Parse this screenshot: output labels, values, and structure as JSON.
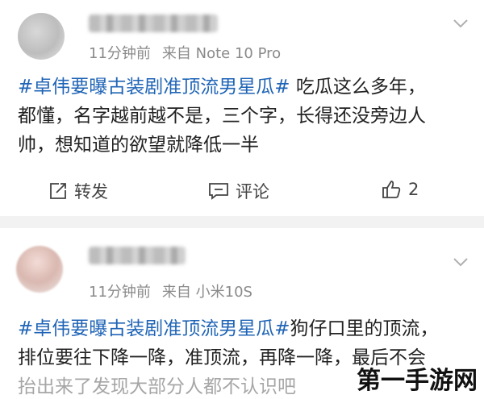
{
  "posts": [
    {
      "time": "11分钟前",
      "source": "来自 Note 10 Pro",
      "topic": "#卓伟要曝古装剧准顶流男星瓜#",
      "lines": [
        " 吃瓜这么多年，",
        "都懂，名字越前越不是，三个字，长得还没旁边人",
        "帅，想知道的欲望就降低一半"
      ],
      "actions": {
        "repost": "转发",
        "comment": "评论",
        "like_count": "2"
      }
    },
    {
      "time": "11分钟前",
      "source": "来自 小米10S",
      "topic": "#卓伟要曝古装剧准顶流男星瓜#",
      "lines": [
        "狗仔口里的顶流，",
        "排位要往下降一降，准顶流，再降一降，最后不会",
        "抬出来了发现大部分人都不认识吧"
      ]
    }
  ],
  "watermark": "第一手游网",
  "icons": {
    "chevron": "chevron-down-icon",
    "repost": "repost-icon",
    "comment": "comment-icon",
    "like": "thumbs-up-icon"
  },
  "colors": {
    "topic": "#1f64b6",
    "meta": "#8a8a8a",
    "divider": "#f2f2f2"
  }
}
